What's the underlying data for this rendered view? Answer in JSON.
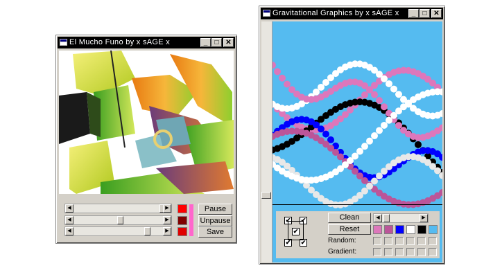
{
  "window_left": {
    "title": "El Mucho Funo by x sAGE x",
    "buttons": {
      "pause": "Pause",
      "unpause": "Unpause",
      "save": "Save"
    },
    "colors": {
      "swatch1": "#ff0000",
      "swatch2": "#800000",
      "swatch3": "#e00000",
      "accent": "#ff66cc"
    }
  },
  "window_right": {
    "title": "Gravitational Graphics by x sAGE x",
    "buttons": {
      "clean": "Clean",
      "reset": "Reset"
    },
    "labels": {
      "random": "Random:",
      "gradient": "Gradient:"
    },
    "background_color": "#55bbf0",
    "palette": [
      "#dd77bb",
      "#bb5599",
      "#0000ff",
      "#ffffff",
      "#000000",
      "#55bbf0"
    ]
  },
  "titlebar_controls": {
    "minimize": "_",
    "maximize": "□",
    "close": "✕"
  }
}
